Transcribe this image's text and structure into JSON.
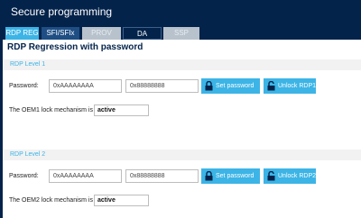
{
  "window": {
    "title": "Secure programming"
  },
  "tabs": [
    {
      "label": "RDP REG"
    },
    {
      "label": "SFI/SFIx"
    },
    {
      "label": "PROV"
    },
    {
      "label": "DA"
    },
    {
      "label": "SSP"
    }
  ],
  "page": {
    "title": "RDP Regression with password"
  },
  "level1": {
    "section_label": "RDP Level 1",
    "password_label": "Password:",
    "password1_value": "0xAAAAAAAA",
    "password2_value": "0x88888888",
    "set_button": "Set password",
    "unlock_button": "Unlock RDP1",
    "lock_text": "The OEM1 lock mechanism is",
    "lock_status": "active"
  },
  "level2": {
    "section_label": "RDP Level 2",
    "password_label": "Password:",
    "password1_value": "0xAAAAAAAA",
    "password2_value": "0x88888888",
    "set_button": "Set password",
    "unlock_button": "Unlock RDP2",
    "lock_text": "The OEM2 lock mechanism is",
    "lock_status": "active"
  },
  "colors": {
    "header": "#03234b",
    "accent": "#3cb4e6",
    "disabled_tab": "#b8c2cc"
  },
  "icons": {
    "button_icon": "lock-icon"
  }
}
